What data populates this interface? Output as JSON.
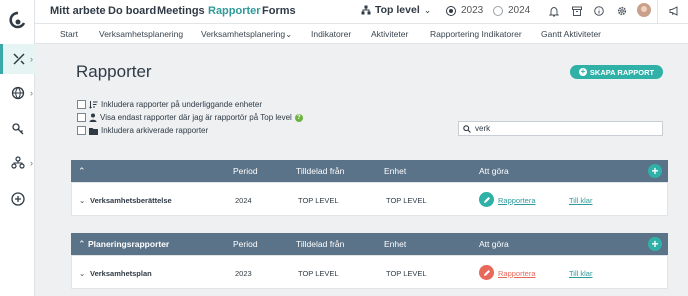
{
  "sidebar": {
    "items": [
      "logo-icon",
      "tools-icon",
      "globe-icon",
      "key-icon",
      "org-icon",
      "add-icon"
    ]
  },
  "topnav": {
    "links": [
      "Mitt arbete",
      "Do board",
      "Meetings",
      "Rapporter",
      "Forms"
    ],
    "level_label": "Top level",
    "years": [
      "2023",
      "2024"
    ],
    "selected_year": "2023"
  },
  "subnav": {
    "links": [
      "Start",
      "Verksamhetsplanering",
      "Verksamhetsplanering",
      "Indikatorer",
      "Aktiviteter",
      "Rapportering Indikatorer",
      "Gantt Aktiviteter"
    ]
  },
  "page": {
    "title": "Rapporter",
    "create_button": "SKAPA RAPPORT",
    "options": [
      "Inkludera rapporter på underliggande enheter",
      "Visa endast rapporter där jag är rapportör på Top level",
      "Inkludera arkiverade rapporter"
    ],
    "search_value": "verk"
  },
  "columns": {
    "period": "Period",
    "assigned_from": "Tilldelad från",
    "unit": "Enhet",
    "todo": "Att göra"
  },
  "groups": [
    {
      "title": "",
      "rows": [
        {
          "name": "Verksamhetsberättelse",
          "period": "2024",
          "assigned_from": "TOP LEVEL",
          "unit": "TOP LEVEL",
          "action": "Rapportera",
          "done": "Till klar"
        }
      ]
    },
    {
      "title": "Planeringsrapporter",
      "rows": [
        {
          "name": "Verksamhetsplan",
          "period": "2023",
          "assigned_from": "TOP LEVEL",
          "unit": "TOP LEVEL",
          "action": "Rapportera",
          "done": "Till klar"
        }
      ]
    }
  ],
  "colors": {
    "accent": "#2fb1a8",
    "header": "#5b7388",
    "link_teal": "#2f9a9a",
    "link_red": "#e8685a"
  }
}
